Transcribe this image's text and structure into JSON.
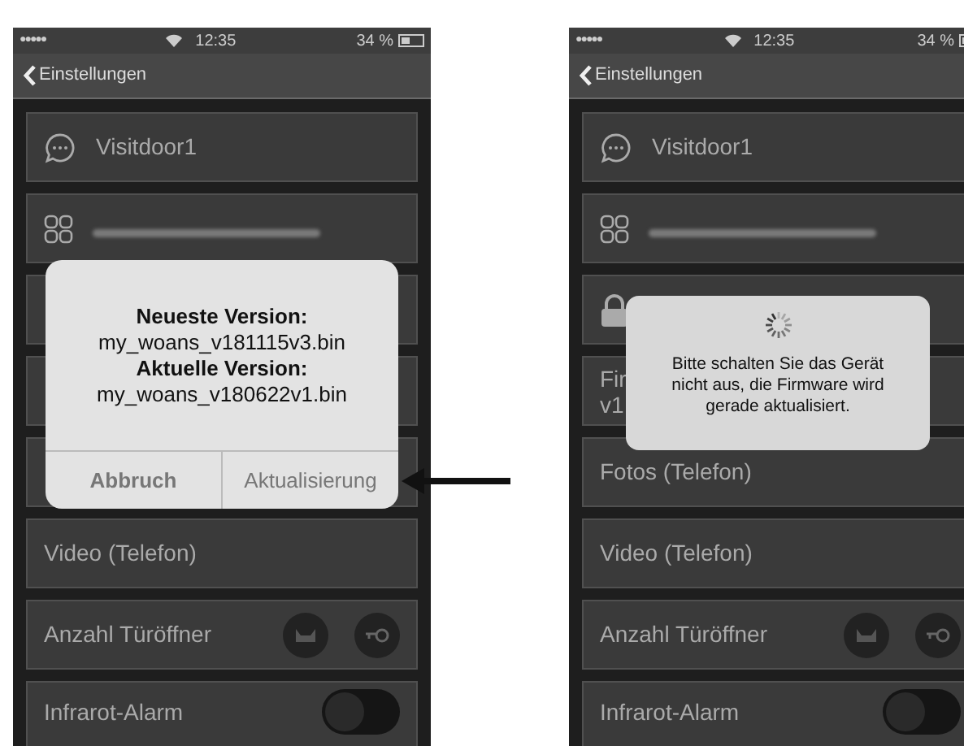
{
  "screens": [
    {
      "status_bar": {
        "signal": "●●●●●",
        "time": "12:35",
        "battery": "34 %"
      },
      "nav": {
        "back": "Einstellungen"
      },
      "rows": [
        {
          "kind": "name",
          "label": "Visitdoor1"
        },
        {
          "kind": "serial"
        },
        {
          "kind": "covered"
        },
        {
          "kind": "covered"
        },
        {
          "kind": "covered"
        },
        {
          "kind": "text",
          "label": "Video (Telefon)"
        },
        {
          "kind": "buttons",
          "label": "Anzahl Türöffner"
        },
        {
          "kind": "toggle",
          "label": "Infrarot-Alarm",
          "on": false
        }
      ],
      "dialog": {
        "kind": "confirm",
        "lines": [
          "Neueste Version:",
          "my_woans_v181115v3.bin",
          "Aktuelle Version:",
          "my_woans_v180622v1.bin"
        ],
        "buttons": [
          "Abbruch",
          "Aktualisierung"
        ]
      }
    },
    {
      "status_bar": {
        "signal": "●●●●●",
        "time": "12:35",
        "battery": "34 %"
      },
      "nav": {
        "back": "Einstellungen"
      },
      "rows": [
        {
          "kind": "name",
          "label": "Visitdoor1"
        },
        {
          "kind": "serial"
        },
        {
          "kind": "lock"
        },
        {
          "kind": "text",
          "label": "Fir",
          "sub": "v1"
        },
        {
          "kind": "text",
          "label": "Fotos (Telefon)"
        },
        {
          "kind": "text",
          "label": "Video (Telefon)"
        },
        {
          "kind": "buttons",
          "label": "Anzahl Türöffner"
        },
        {
          "kind": "toggle",
          "label": "Infrarot-Alarm",
          "on": false
        }
      ],
      "dialog": {
        "kind": "progress",
        "lines": [
          "Bitte schalten Sie das Gerät nicht aus, die Firmware wird gerade aktualisiert."
        ]
      }
    }
  ]
}
